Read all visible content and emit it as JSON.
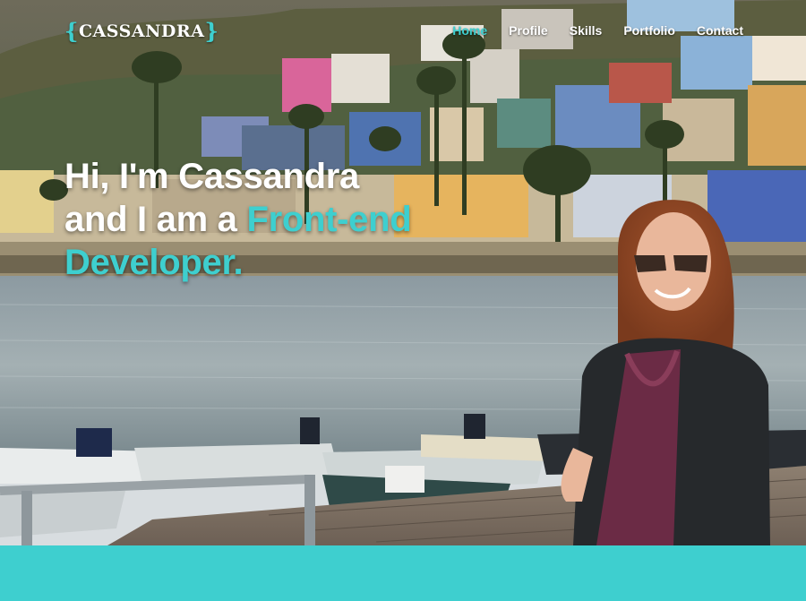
{
  "brand": {
    "name": "CASSANDRA",
    "brace_open": "{",
    "brace_close": "}"
  },
  "nav": {
    "items": [
      "Home",
      "Profile",
      "Skills",
      "Portfolio",
      "Contact"
    ],
    "active": "Home"
  },
  "hero": {
    "line1": "Hi, I'm Cassandra",
    "line2_prefix": "and I am a ",
    "line2_accent": "Front-end",
    "line3_accent": "Developer."
  },
  "colors": {
    "accent": "#3ecfcf",
    "text": "#ffffff"
  }
}
